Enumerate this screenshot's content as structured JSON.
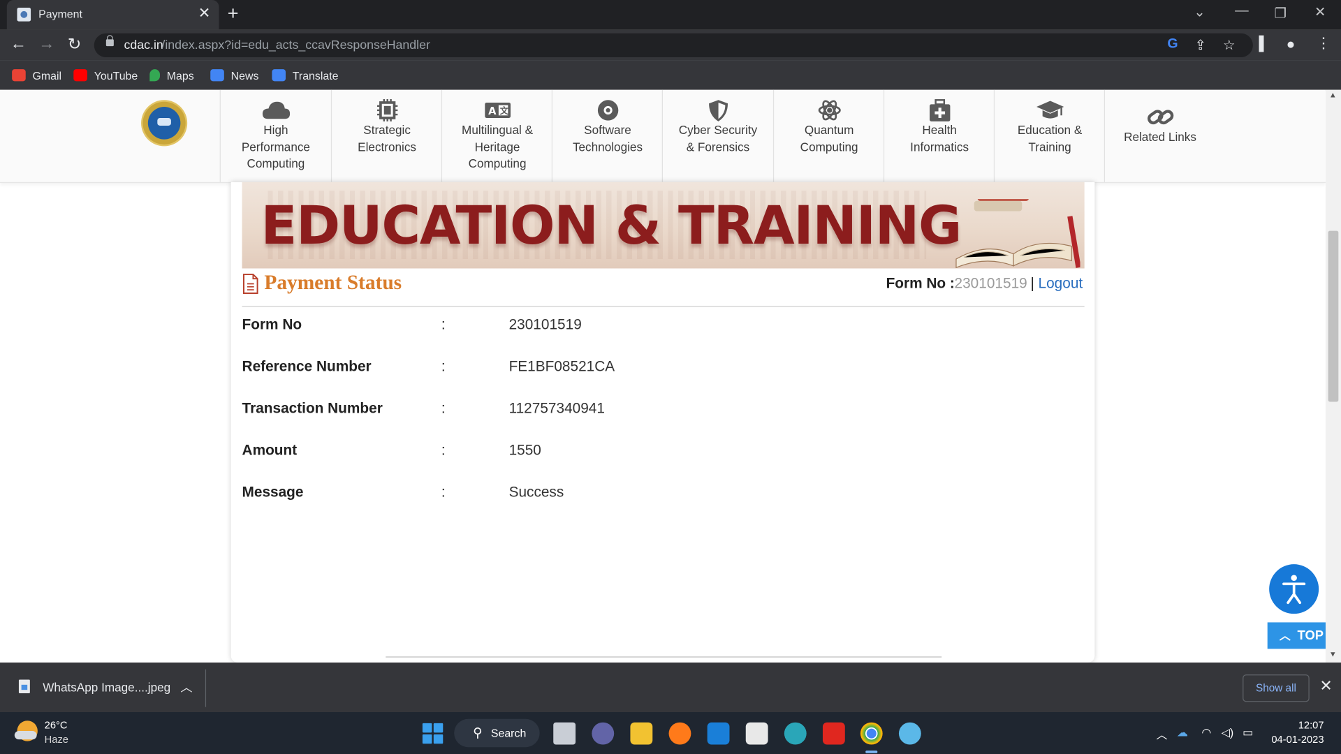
{
  "browser": {
    "tab_title": "Payment",
    "url_host": "cdac.in",
    "url_path": "/index.aspx?id=edu_acts_ccavResponseHandler",
    "bookmarks": [
      {
        "label": "Gmail",
        "icon": "gmail-icon",
        "color": "#ea4335"
      },
      {
        "label": "YouTube",
        "icon": "youtube-icon",
        "color": "#ff0000"
      },
      {
        "label": "Maps",
        "icon": "maps-icon",
        "color": "#34a853"
      },
      {
        "label": "News",
        "icon": "news-icon",
        "color": "#4285f4"
      },
      {
        "label": "Translate",
        "icon": "translate-icon",
        "color": "#4285f4"
      }
    ]
  },
  "site_nav": [
    {
      "label": "High\nPerformance\nComputing",
      "icon": "cloud-icon"
    },
    {
      "label": "Strategic\nElectronics",
      "icon": "chip-icon"
    },
    {
      "label": "Multilingual &\nHeritage\nComputing",
      "icon": "language-icon"
    },
    {
      "label": "Software\nTechnologies",
      "icon": "disc-icon"
    },
    {
      "label": "Cyber Security\n& Forensics",
      "icon": "shield-icon"
    },
    {
      "label": "Quantum\nComputing",
      "icon": "atom-icon"
    },
    {
      "label": "Health\nInformatics",
      "icon": "medkit-icon"
    },
    {
      "label": "Education &\nTraining",
      "icon": "graduation-cap-icon"
    },
    {
      "label": "Related Links",
      "icon": "link-icon"
    }
  ],
  "banner": {
    "text": "EDUCATION & TRAINING"
  },
  "payment": {
    "title": "Payment Status",
    "form_no_label": "Form No :",
    "form_no_value": "230101519",
    "separator": "|",
    "logout": "Logout",
    "rows": [
      {
        "key": "Form No",
        "colon": ":",
        "value": "230101519"
      },
      {
        "key": "Reference Number",
        "colon": ":",
        "value": "FE1BF08521CA"
      },
      {
        "key": "Transaction Number",
        "colon": ":",
        "value": "112757340941"
      },
      {
        "key": "Amount",
        "colon": ":",
        "value": "1550"
      },
      {
        "key": "Message",
        "colon": ":",
        "value": "Success"
      }
    ]
  },
  "floating": {
    "top_label": "TOP"
  },
  "download_bar": {
    "file_name": "WhatsApp Image....jpeg",
    "show_all": "Show all"
  },
  "taskbar": {
    "temperature": "26°C",
    "weather": "Haze",
    "search_label": "Search",
    "time": "12:07",
    "date": "04-01-2023"
  },
  "colors": {
    "accent_orange": "#d97c2b",
    "link_blue": "#2a6ebf",
    "banner_red": "#8c1d1d"
  }
}
